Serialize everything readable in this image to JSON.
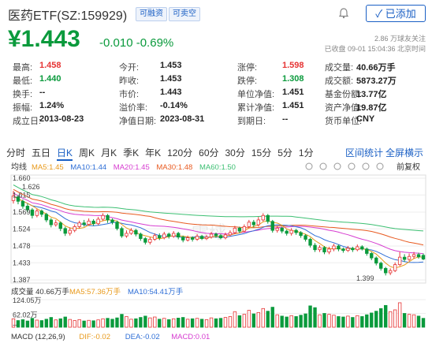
{
  "header": {
    "title": "医药ETF(SZ:159929)",
    "tags": [
      "可融资",
      "可卖空"
    ],
    "add_label": "✓ 已添加"
  },
  "price": {
    "current": "¥1.443",
    "change": "-0.010",
    "change_pct": "-0.69%",
    "followers": "2.86 万球友关注",
    "status": "已收盘 09-01 15:04:36 北京时间"
  },
  "quotes": [
    [
      {
        "l": "最高:",
        "v": "1.458",
        "c": "red"
      },
      {
        "l": "今开:",
        "v": "1.453",
        "c": ""
      },
      {
        "l": "涨停:",
        "v": "1.598",
        "c": "red"
      },
      {
        "l": "成交量:",
        "v": "40.66万手",
        "c": ""
      }
    ],
    [
      {
        "l": "最低:",
        "v": "1.440",
        "c": "green"
      },
      {
        "l": "昨收:",
        "v": "1.453",
        "c": ""
      },
      {
        "l": "跌停:",
        "v": "1.308",
        "c": "green"
      },
      {
        "l": "成交额:",
        "v": "5873.27万",
        "c": ""
      }
    ],
    [
      {
        "l": "换手:",
        "v": "--",
        "c": ""
      },
      {
        "l": "市价:",
        "v": "1.443",
        "c": ""
      },
      {
        "l": "单位净值:",
        "v": "1.451",
        "c": ""
      },
      {
        "l": "基金份额:",
        "v": "13.77亿",
        "c": ""
      }
    ],
    [
      {
        "l": "振幅:",
        "v": "1.24%",
        "c": ""
      },
      {
        "l": "溢价率:",
        "v": "-0.14%",
        "c": ""
      },
      {
        "l": "累计净值:",
        "v": "1.451",
        "c": ""
      },
      {
        "l": "资产净值:",
        "v": "19.87亿",
        "c": ""
      }
    ],
    [
      {
        "l": "成立日:",
        "v": "2013-08-23",
        "c": ""
      },
      {
        "l": "净值日期:",
        "v": "2023-08-31",
        "c": ""
      },
      {
        "l": "到期日:",
        "v": "--",
        "c": ""
      },
      {
        "l": "货币单位:",
        "v": "CNY",
        "c": ""
      }
    ]
  ],
  "period_tabs": [
    "分时",
    "五日",
    "日K",
    "周K",
    "月K",
    "季K",
    "年K",
    "120分",
    "60分",
    "30分",
    "15分",
    "5分",
    "1分"
  ],
  "active_tab": "日K",
  "right_tabs": [
    "区间统计",
    "全屏横示"
  ],
  "chart_controls": {
    "left": "均线",
    "right": "前复权"
  },
  "ma_legend": [
    {
      "t": "MA5:1.45",
      "c": "#e89a1c"
    },
    {
      "t": "MA10:1.44",
      "c": "#2f6fd6"
    },
    {
      "t": "MA20:1.45",
      "c": "#d63cd0"
    },
    {
      "t": "MA30:1.48",
      "c": "#e85a20"
    },
    {
      "t": "MA60:1.50",
      "c": "#3cbf72"
    }
  ],
  "vol_legend": [
    {
      "t": "成交量 40.66万手",
      "c": "#333"
    },
    {
      "t": "MA5:57.36万手",
      "c": "#e89a1c"
    },
    {
      "t": "MA10:54.41万手",
      "c": "#2f6fd6"
    }
  ],
  "macd_legend": [
    {
      "t": "MACD (12,26,9)",
      "c": "#333"
    },
    {
      "t": "DIF:-0.02",
      "c": "#e89a1c"
    },
    {
      "t": "DEA:-0.02",
      "c": "#2f6fd6"
    },
    {
      "t": "MACD:0.01",
      "c": "#d63cd0"
    }
  ],
  "chart_data": {
    "type": "candlestick",
    "y_ticks": [
      "1.660",
      "1.615",
      "1.569",
      "1.524",
      "1.478",
      "1.433",
      "1.387"
    ],
    "ylim": [
      1.387,
      1.66
    ],
    "high_label": "1.626",
    "low_label": "1.399",
    "vol_ticks": [
      "124.05万",
      "62.02万",
      "--"
    ],
    "vol_max": 124.05,
    "candles": [
      [
        1.6,
        1.612,
        1.626,
        1.592
      ],
      [
        1.61,
        1.598,
        1.615,
        1.59
      ],
      [
        1.598,
        1.585,
        1.603,
        1.578
      ],
      [
        1.585,
        1.575,
        1.592,
        1.568
      ],
      [
        1.575,
        1.56,
        1.58,
        1.552
      ],
      [
        1.56,
        1.572,
        1.578,
        1.555
      ],
      [
        1.572,
        1.563,
        1.576,
        1.556
      ],
      [
        1.563,
        1.548,
        1.567,
        1.542
      ],
      [
        1.548,
        1.535,
        1.553,
        1.528
      ],
      [
        1.535,
        1.54,
        1.548,
        1.53
      ],
      [
        1.54,
        1.525,
        1.544,
        1.518
      ],
      [
        1.525,
        1.512,
        1.53,
        1.505
      ],
      [
        1.512,
        1.52,
        1.528,
        1.506
      ],
      [
        1.52,
        1.53,
        1.536,
        1.515
      ],
      [
        1.53,
        1.54,
        1.546,
        1.525
      ],
      [
        1.54,
        1.536,
        1.548,
        1.53
      ],
      [
        1.536,
        1.545,
        1.552,
        1.532
      ],
      [
        1.545,
        1.538,
        1.55,
        1.532
      ],
      [
        1.538,
        1.55,
        1.556,
        1.534
      ],
      [
        1.55,
        1.56,
        1.566,
        1.545
      ],
      [
        1.56,
        1.548,
        1.564,
        1.54
      ],
      [
        1.548,
        1.542,
        1.552,
        1.536
      ],
      [
        1.542,
        1.525,
        1.546,
        1.52
      ],
      [
        1.525,
        1.505,
        1.53,
        1.5
      ],
      [
        1.505,
        1.512,
        1.52,
        1.5
      ],
      [
        1.512,
        1.52,
        1.526,
        1.508
      ],
      [
        1.52,
        1.51,
        1.524,
        1.504
      ],
      [
        1.51,
        1.498,
        1.514,
        1.492
      ],
      [
        1.498,
        1.488,
        1.502,
        1.482
      ],
      [
        1.488,
        1.496,
        1.502,
        1.482
      ],
      [
        1.496,
        1.506,
        1.512,
        1.492
      ],
      [
        1.506,
        1.5,
        1.512,
        1.494
      ],
      [
        1.5,
        1.51,
        1.516,
        1.496
      ],
      [
        1.51,
        1.504,
        1.514,
        1.498
      ],
      [
        1.504,
        1.512,
        1.518,
        1.5
      ],
      [
        1.512,
        1.502,
        1.516,
        1.496
      ],
      [
        1.502,
        1.494,
        1.506,
        1.488
      ],
      [
        1.494,
        1.5,
        1.506,
        1.49
      ],
      [
        1.5,
        1.496,
        1.504,
        1.49
      ],
      [
        1.496,
        1.504,
        1.51,
        1.492
      ],
      [
        1.504,
        1.498,
        1.508,
        1.494
      ],
      [
        1.498,
        1.502,
        1.508,
        1.494
      ],
      [
        1.502,
        1.51,
        1.516,
        1.498
      ],
      [
        1.51,
        1.506,
        1.514,
        1.5
      ],
      [
        1.506,
        1.5,
        1.51,
        1.496
      ],
      [
        1.5,
        1.508,
        1.514,
        1.496
      ],
      [
        1.508,
        1.514,
        1.52,
        1.504
      ],
      [
        1.514,
        1.526,
        1.532,
        1.51
      ],
      [
        1.526,
        1.518,
        1.53,
        1.512
      ],
      [
        1.518,
        1.53,
        1.536,
        1.514
      ],
      [
        1.53,
        1.542,
        1.548,
        1.526
      ],
      [
        1.542,
        1.535,
        1.548,
        1.528
      ],
      [
        1.535,
        1.548,
        1.556,
        1.53
      ],
      [
        1.548,
        1.56,
        1.566,
        1.544
      ],
      [
        1.56,
        1.544,
        1.564,
        1.538
      ],
      [
        1.544,
        1.52,
        1.548,
        1.514
      ],
      [
        1.52,
        1.526,
        1.532,
        1.514
      ],
      [
        1.526,
        1.518,
        1.53,
        1.512
      ],
      [
        1.518,
        1.512,
        1.522,
        1.506
      ],
      [
        1.512,
        1.52,
        1.526,
        1.506
      ],
      [
        1.52,
        1.514,
        1.524,
        1.508
      ],
      [
        1.514,
        1.506,
        1.518,
        1.5
      ],
      [
        1.506,
        1.496,
        1.51,
        1.49
      ],
      [
        1.496,
        1.48,
        1.5,
        1.474
      ],
      [
        1.48,
        1.468,
        1.486,
        1.462
      ],
      [
        1.468,
        1.474,
        1.48,
        1.462
      ],
      [
        1.474,
        1.462,
        1.478,
        1.456
      ],
      [
        1.462,
        1.47,
        1.476,
        1.456
      ],
      [
        1.47,
        1.478,
        1.484,
        1.464
      ],
      [
        1.478,
        1.47,
        1.482,
        1.464
      ],
      [
        1.47,
        1.466,
        1.474,
        1.46
      ],
      [
        1.466,
        1.472,
        1.478,
        1.462
      ],
      [
        1.472,
        1.468,
        1.476,
        1.462
      ],
      [
        1.468,
        1.476,
        1.482,
        1.464
      ],
      [
        1.476,
        1.47,
        1.48,
        1.466
      ],
      [
        1.47,
        1.458,
        1.474,
        1.452
      ],
      [
        1.458,
        1.446,
        1.462,
        1.44
      ],
      [
        1.446,
        1.432,
        1.45,
        1.426
      ],
      [
        1.432,
        1.418,
        1.436,
        1.412
      ],
      [
        1.418,
        1.406,
        1.422,
        1.399
      ],
      [
        1.406,
        1.412,
        1.418,
        1.4
      ],
      [
        1.412,
        1.428,
        1.434,
        1.408
      ],
      [
        1.428,
        1.448,
        1.462,
        1.424
      ],
      [
        1.448,
        1.442,
        1.456,
        1.436
      ],
      [
        1.442,
        1.45,
        1.458,
        1.438
      ],
      [
        1.45,
        1.455,
        1.462,
        1.444
      ],
      [
        1.455,
        1.449,
        1.46,
        1.444
      ],
      [
        1.453,
        1.443,
        1.458,
        1.44
      ]
    ],
    "volumes": [
      38,
      30,
      34,
      28,
      40,
      32,
      30,
      36,
      44,
      33,
      38,
      46,
      35,
      30,
      34,
      28,
      31,
      29,
      33,
      38,
      40,
      36,
      42,
      58,
      48,
      36,
      38,
      44,
      50,
      42,
      46,
      36,
      40,
      34,
      38,
      41,
      44,
      36,
      38,
      40,
      36,
      34,
      42,
      38,
      40,
      44,
      48,
      70,
      52,
      58,
      76,
      60,
      66,
      84,
      72,
      90,
      56,
      50,
      46,
      52,
      48,
      54,
      60,
      96,
      88,
      56,
      62,
      58,
      54,
      48,
      46,
      50,
      44,
      52,
      48,
      56,
      64,
      72,
      84,
      98,
      70,
      78,
      110,
      62,
      58,
      56,
      50,
      40
    ],
    "macd": [
      0.01,
      0.008,
      0.006,
      0.004,
      0.002,
      0.001,
      -0.001,
      -0.003,
      -0.005,
      -0.004,
      -0.006,
      -0.008,
      -0.006,
      -0.004,
      -0.002,
      -0.001,
      0.001,
      0.001,
      0.002,
      0.003,
      0.002,
      0.001,
      -0.002,
      -0.005,
      -0.004,
      -0.003,
      -0.003,
      -0.005,
      -0.006,
      -0.004,
      -0.002,
      -0.002,
      -0.001,
      -0.001,
      0,
      -0.001,
      -0.002,
      -0.001,
      -0.001,
      0,
      0,
      0.001,
      0.002,
      0.002,
      0.001,
      0.002,
      0.003,
      0.005,
      0.004,
      0.006,
      0.008,
      0.007,
      0.009,
      0.011,
      0.008,
      0.003,
      0.002,
      0.001,
      -0.001,
      0,
      -0.001,
      -0.003,
      -0.005,
      -0.008,
      -0.01,
      -0.008,
      -0.009,
      -0.007,
      -0.005,
      -0.005,
      -0.005,
      -0.004,
      -0.004,
      -0.003,
      -0.003,
      -0.005,
      -0.007,
      -0.01,
      -0.012,
      -0.013,
      -0.011,
      -0.007,
      -0.002,
      0.001,
      0.004,
      0.006,
      0.007,
      0.01
    ]
  }
}
